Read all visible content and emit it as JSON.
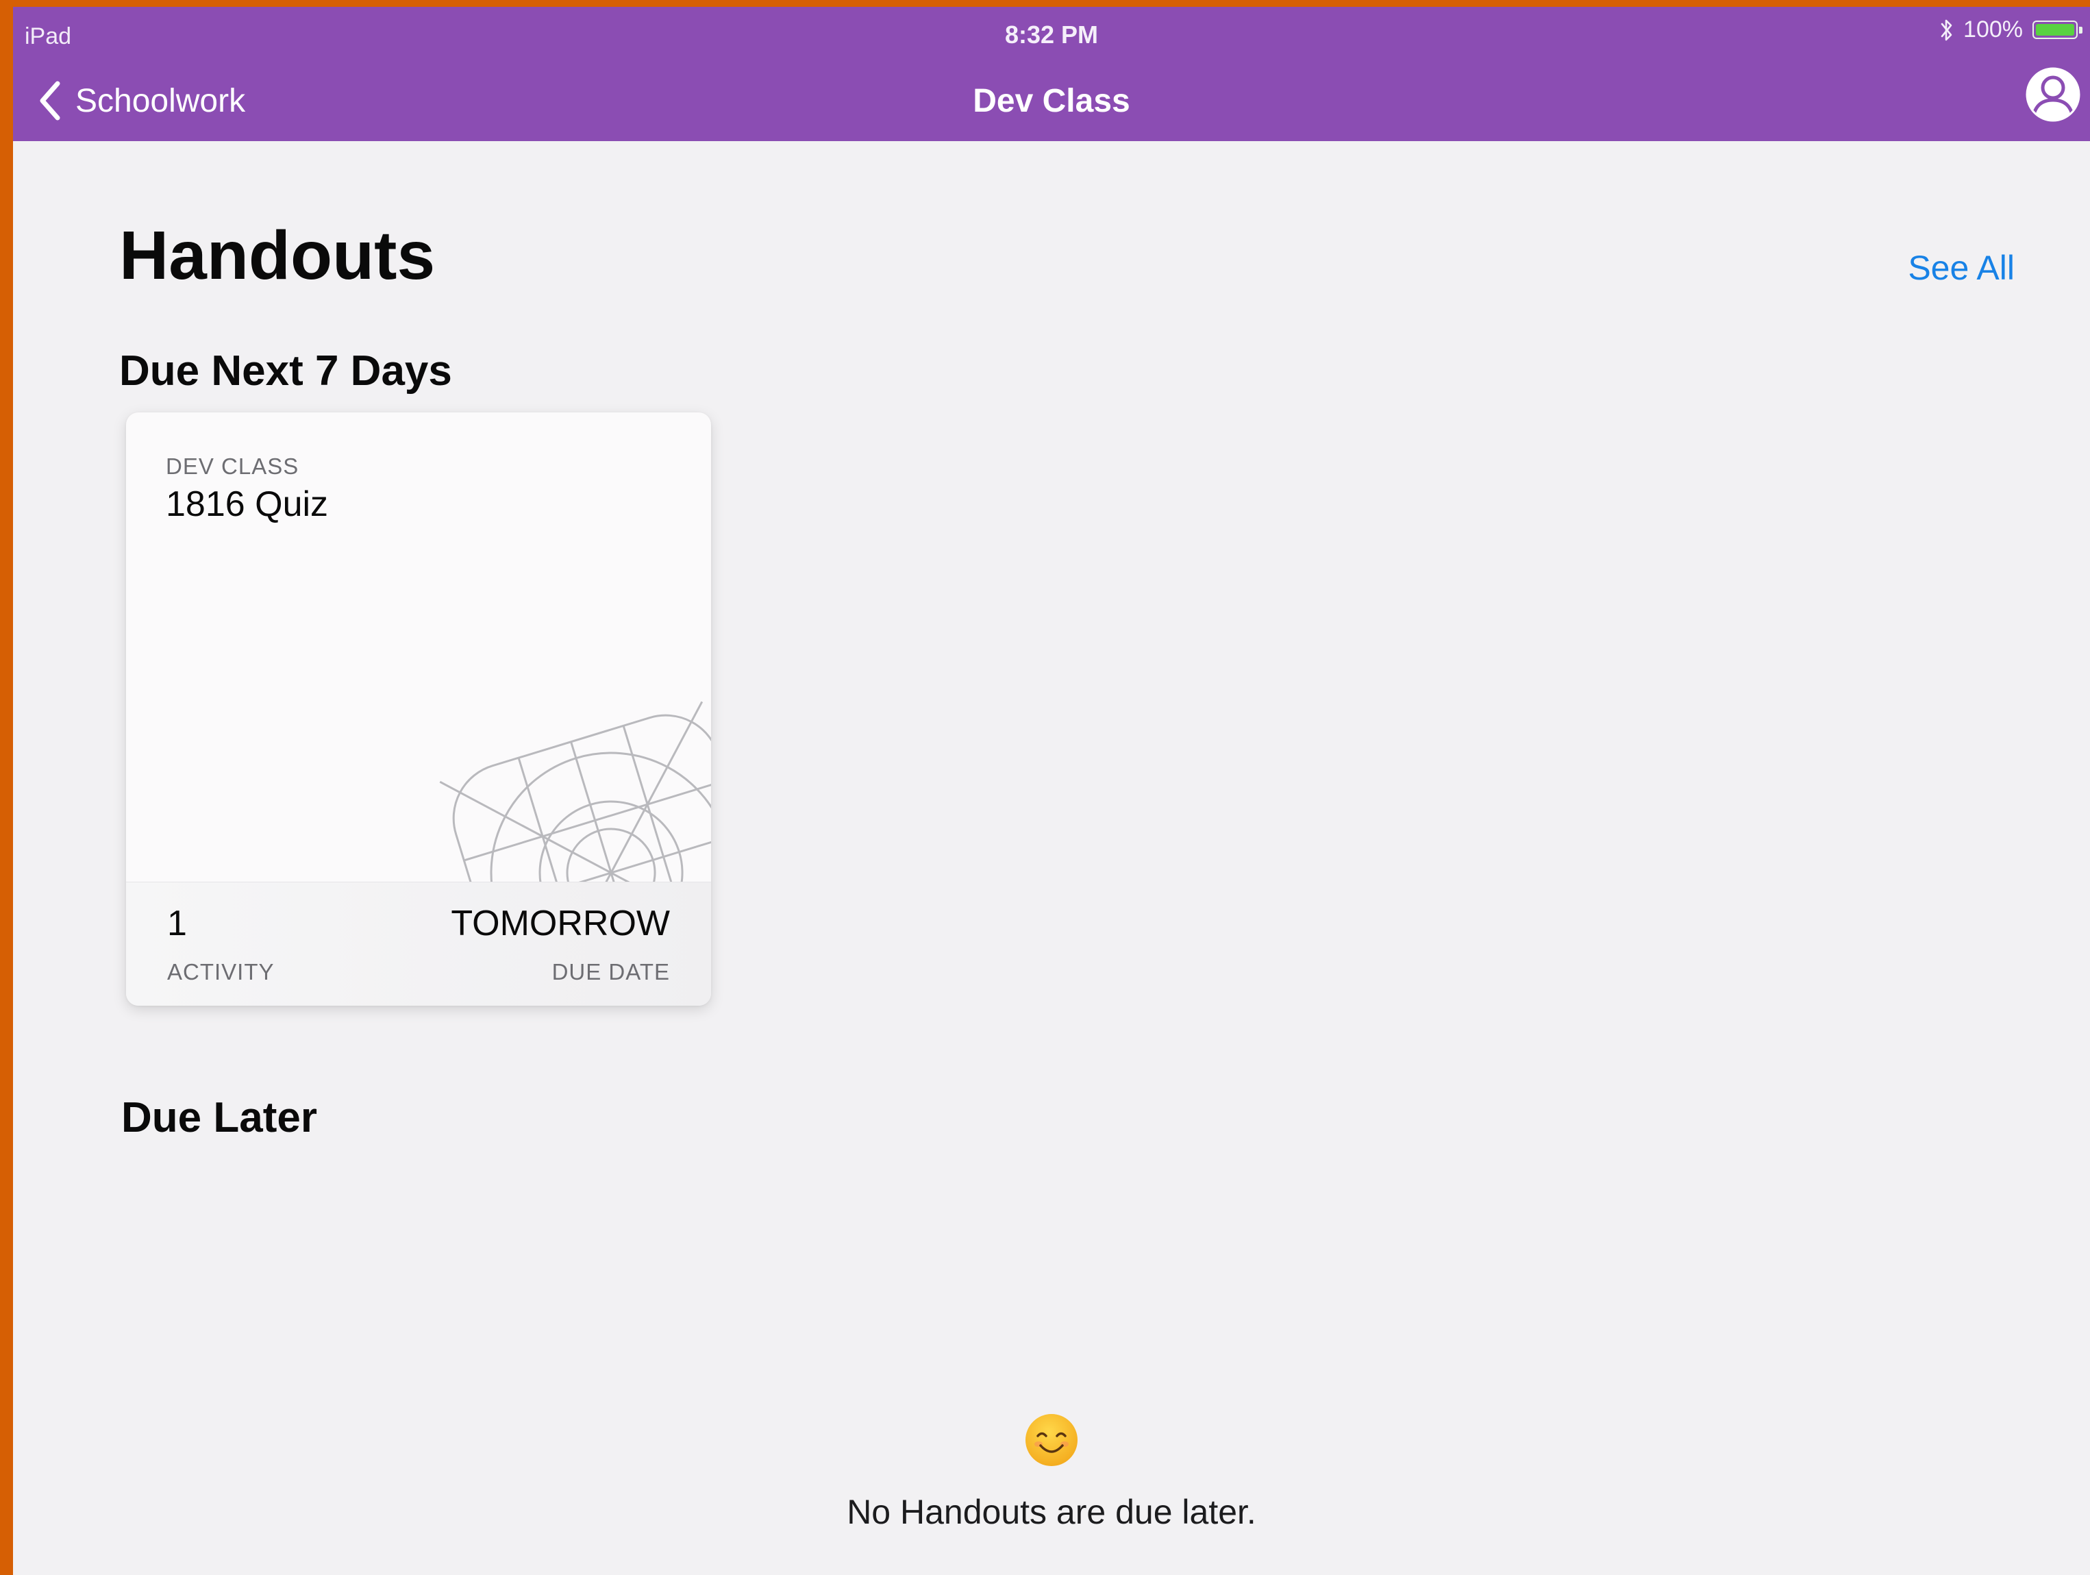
{
  "status_bar": {
    "device": "iPad",
    "time": "8:32 PM",
    "battery": "100%",
    "battery_level": 1.0,
    "battery_color": "#59d241"
  },
  "nav": {
    "back_label": "Schoolwork",
    "title": "Dev Class",
    "bar_color": "#8b4db3"
  },
  "main": {
    "title": "Handouts",
    "see_all": "See All",
    "link_color": "#1882e6",
    "sections": {
      "next": "Due Next 7 Days",
      "later": "Due Later"
    }
  },
  "cards": [
    {
      "class_name": "DEV CLASS",
      "title": "1816 Quiz",
      "activity_count": "1",
      "activity_label": "ACTIVITY",
      "due_value": "TOMORROW",
      "due_label": "DUE DATE"
    }
  ],
  "empty_state": {
    "icon": "smiley-icon",
    "message": "No Handouts are due later."
  }
}
